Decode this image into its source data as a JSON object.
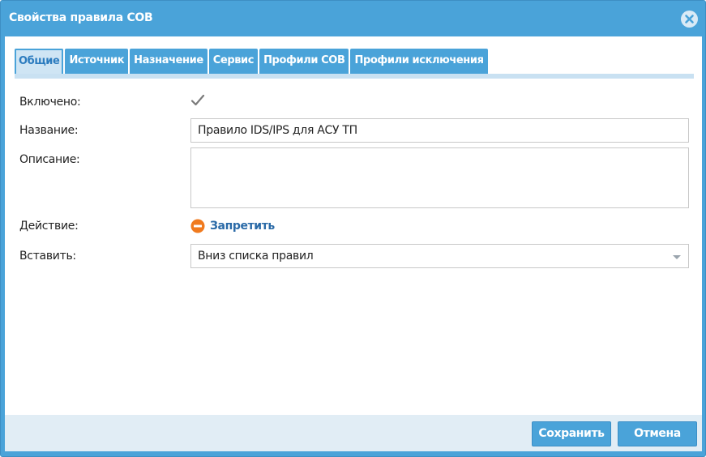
{
  "window": {
    "title": "Свойства правила СОВ"
  },
  "tabs": [
    {
      "label": "Общие",
      "active": true
    },
    {
      "label": "Источник",
      "active": false
    },
    {
      "label": "Назначение",
      "active": false
    },
    {
      "label": "Сервис",
      "active": false
    },
    {
      "label": "Профили СОВ",
      "active": false
    },
    {
      "label": "Профили исключения",
      "active": false
    }
  ],
  "form": {
    "enabled_label": "Включено:",
    "enabled_checked": true,
    "name_label": "Название:",
    "name_value": "Правило IDS/IPS для АСУ ТП",
    "description_label": "Описание:",
    "description_value": "",
    "action_label": "Действие:",
    "action_value": "Запретить",
    "action_icon": "deny-icon",
    "insert_label": "Вставить:",
    "insert_value": "Вниз списка правил"
  },
  "footer": {
    "save_label": "Сохранить",
    "cancel_label": "Отмена"
  },
  "colors": {
    "accent": "#4aa3d9",
    "deny": "#f07a1e",
    "link": "#2a6aa7"
  }
}
